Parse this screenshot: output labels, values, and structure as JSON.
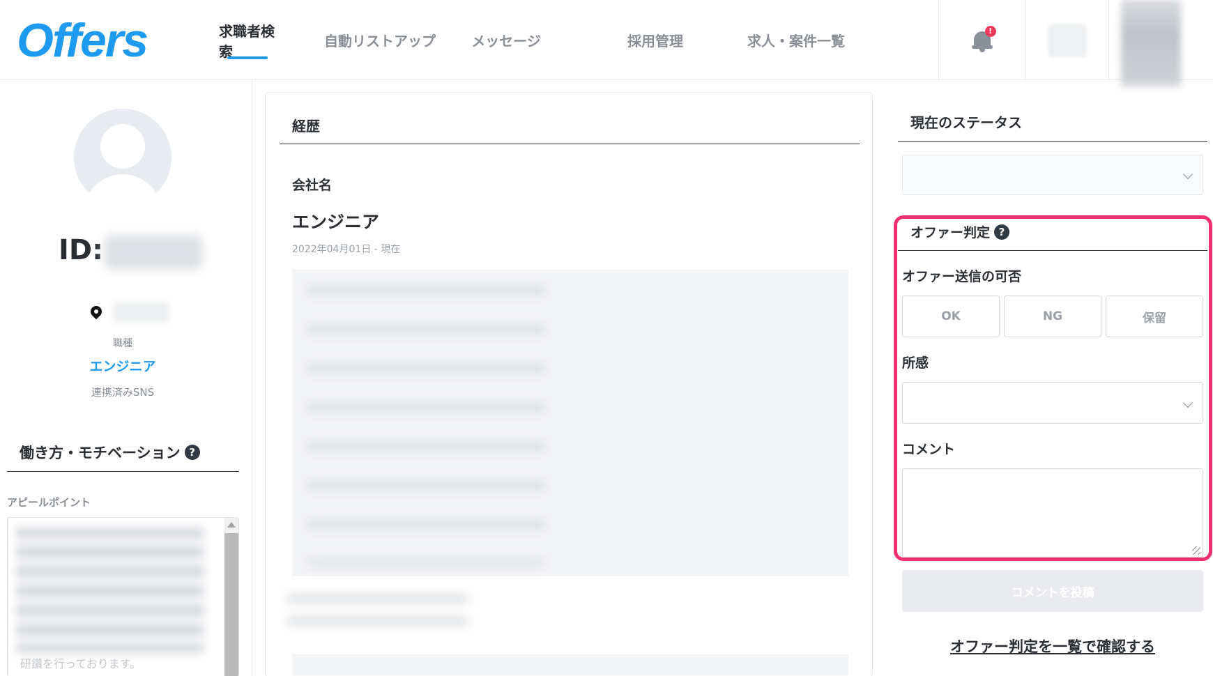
{
  "header": {
    "logo": "Offers",
    "nav": [
      {
        "label": "求職者検索",
        "active": true
      },
      {
        "label": "自動リストアップ",
        "active": false
      },
      {
        "label": "メッセージ",
        "active": false
      },
      {
        "label": "採用管理",
        "active": false
      },
      {
        "label": "求人・案件一覧",
        "active": false
      }
    ],
    "notification_badge": "!",
    "accent_color": "#1e9bf0"
  },
  "profile": {
    "id_label": "ID:",
    "job_type_label": "職種",
    "job_type_value": "エンジニア",
    "sns_label": "連携済みSNS",
    "work_style_title": "働き方・モチベーション",
    "appeal_point_label": "アピールポイント",
    "appeal_tail": "研鑽を行っております。"
  },
  "career": {
    "title": "経歴",
    "company_label": "会社名",
    "role": "エンジニア",
    "period": "2022年04月01日 - 現在"
  },
  "status_panel": {
    "title": "現在のステータス",
    "offer_judgement_title": "オファー判定",
    "send_possible_label": "オファー送信の可否",
    "options": [
      "OK",
      "NG",
      "保留"
    ],
    "impression_label": "所感",
    "comment_label": "コメント",
    "post_button": "コメントを投稿",
    "list_link": "オファー判定を一覧で確認する",
    "highlight_color": "#f0306e"
  },
  "help_icon": "?"
}
